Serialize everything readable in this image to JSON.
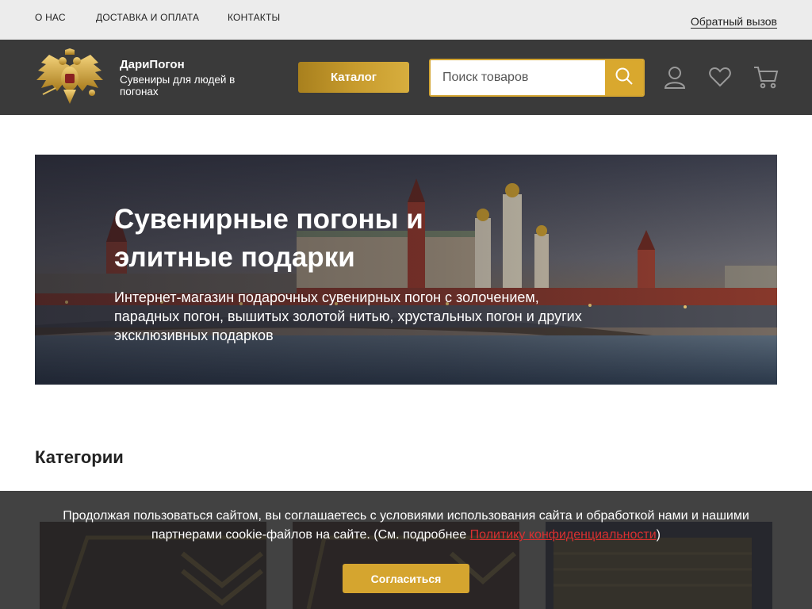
{
  "topnav": {
    "items": [
      "О НАС",
      "ДОСТАВКА И ОПЛАТА",
      "КОНТАКТЫ"
    ],
    "callback_label": "Обратный вызов"
  },
  "header": {
    "brand_name": "ДариПогон",
    "brand_tagline": "Сувениры для людей в погонах",
    "catalog_label": "Каталог",
    "search_placeholder": "Поиск товаров",
    "icons": [
      "user-icon",
      "heart-icon",
      "cart-icon",
      "search-icon"
    ]
  },
  "hero": {
    "title": "Сувенирные погоны и элитные подарки",
    "text": "Интернет-магазин подарочных сувенирных погон с золочением, парадных погон, вышитых золотой нитью, хрустальных погон и других эксклюзивных подарков"
  },
  "categories": {
    "title": "Категории"
  },
  "cookie": {
    "text": "Продолжая пользоваться сайтом, вы соглашаетесь с условиями использования сайта и обработкой нами и нашими партнерами cookie-файлов на сайте. (См. подробнее ",
    "link": "Политику конфиденциальности",
    "text_end": ")",
    "accept_label": "Согласиться"
  },
  "colors": {
    "gold": "#d5a52f",
    "header_bg": "#3a3a3a",
    "topbar_bg": "#ececec",
    "link_red": "#d93030"
  }
}
